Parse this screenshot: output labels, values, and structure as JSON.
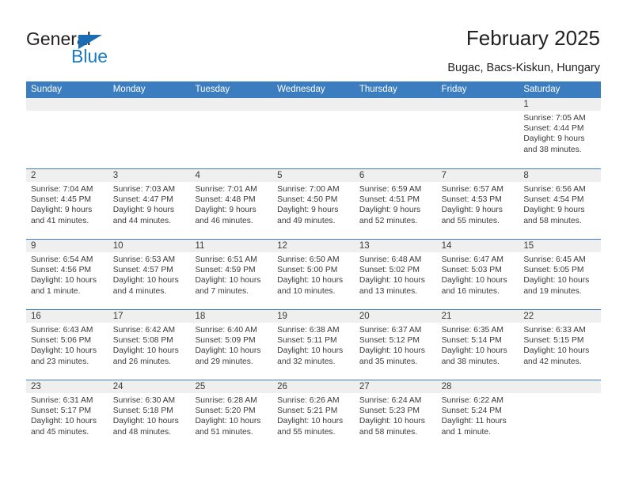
{
  "brand": {
    "word_general": "General",
    "word_blue": "Blue",
    "accent_color": "#3b7dbf",
    "logo_blue": "#1a7ac4"
  },
  "header": {
    "title": "February 2025",
    "subtitle": "Bugac, Bacs-Kiskun, Hungary"
  },
  "calendar": {
    "weekdays": [
      "Sunday",
      "Monday",
      "Tuesday",
      "Wednesday",
      "Thursday",
      "Friday",
      "Saturday"
    ],
    "weeks": [
      [
        {
          "day": "",
          "sunrise": "",
          "sunset": "",
          "daylight": "",
          "empty": true
        },
        {
          "day": "",
          "sunrise": "",
          "sunset": "",
          "daylight": "",
          "empty": true
        },
        {
          "day": "",
          "sunrise": "",
          "sunset": "",
          "daylight": "",
          "empty": true
        },
        {
          "day": "",
          "sunrise": "",
          "sunset": "",
          "daylight": "",
          "empty": true
        },
        {
          "day": "",
          "sunrise": "",
          "sunset": "",
          "daylight": "",
          "empty": true
        },
        {
          "day": "",
          "sunrise": "",
          "sunset": "",
          "daylight": "",
          "empty": true
        },
        {
          "day": "1",
          "sunrise": "Sunrise: 7:05 AM",
          "sunset": "Sunset: 4:44 PM",
          "daylight": "Daylight: 9 hours and 38 minutes.",
          "empty": false
        }
      ],
      [
        {
          "day": "2",
          "sunrise": "Sunrise: 7:04 AM",
          "sunset": "Sunset: 4:45 PM",
          "daylight": "Daylight: 9 hours and 41 minutes.",
          "empty": false
        },
        {
          "day": "3",
          "sunrise": "Sunrise: 7:03 AM",
          "sunset": "Sunset: 4:47 PM",
          "daylight": "Daylight: 9 hours and 44 minutes.",
          "empty": false
        },
        {
          "day": "4",
          "sunrise": "Sunrise: 7:01 AM",
          "sunset": "Sunset: 4:48 PM",
          "daylight": "Daylight: 9 hours and 46 minutes.",
          "empty": false
        },
        {
          "day": "5",
          "sunrise": "Sunrise: 7:00 AM",
          "sunset": "Sunset: 4:50 PM",
          "daylight": "Daylight: 9 hours and 49 minutes.",
          "empty": false
        },
        {
          "day": "6",
          "sunrise": "Sunrise: 6:59 AM",
          "sunset": "Sunset: 4:51 PM",
          "daylight": "Daylight: 9 hours and 52 minutes.",
          "empty": false
        },
        {
          "day": "7",
          "sunrise": "Sunrise: 6:57 AM",
          "sunset": "Sunset: 4:53 PM",
          "daylight": "Daylight: 9 hours and 55 minutes.",
          "empty": false
        },
        {
          "day": "8",
          "sunrise": "Sunrise: 6:56 AM",
          "sunset": "Sunset: 4:54 PM",
          "daylight": "Daylight: 9 hours and 58 minutes.",
          "empty": false
        }
      ],
      [
        {
          "day": "9",
          "sunrise": "Sunrise: 6:54 AM",
          "sunset": "Sunset: 4:56 PM",
          "daylight": "Daylight: 10 hours and 1 minute.",
          "empty": false
        },
        {
          "day": "10",
          "sunrise": "Sunrise: 6:53 AM",
          "sunset": "Sunset: 4:57 PM",
          "daylight": "Daylight: 10 hours and 4 minutes.",
          "empty": false
        },
        {
          "day": "11",
          "sunrise": "Sunrise: 6:51 AM",
          "sunset": "Sunset: 4:59 PM",
          "daylight": "Daylight: 10 hours and 7 minutes.",
          "empty": false
        },
        {
          "day": "12",
          "sunrise": "Sunrise: 6:50 AM",
          "sunset": "Sunset: 5:00 PM",
          "daylight": "Daylight: 10 hours and 10 minutes.",
          "empty": false
        },
        {
          "day": "13",
          "sunrise": "Sunrise: 6:48 AM",
          "sunset": "Sunset: 5:02 PM",
          "daylight": "Daylight: 10 hours and 13 minutes.",
          "empty": false
        },
        {
          "day": "14",
          "sunrise": "Sunrise: 6:47 AM",
          "sunset": "Sunset: 5:03 PM",
          "daylight": "Daylight: 10 hours and 16 minutes.",
          "empty": false
        },
        {
          "day": "15",
          "sunrise": "Sunrise: 6:45 AM",
          "sunset": "Sunset: 5:05 PM",
          "daylight": "Daylight: 10 hours and 19 minutes.",
          "empty": false
        }
      ],
      [
        {
          "day": "16",
          "sunrise": "Sunrise: 6:43 AM",
          "sunset": "Sunset: 5:06 PM",
          "daylight": "Daylight: 10 hours and 23 minutes.",
          "empty": false
        },
        {
          "day": "17",
          "sunrise": "Sunrise: 6:42 AM",
          "sunset": "Sunset: 5:08 PM",
          "daylight": "Daylight: 10 hours and 26 minutes.",
          "empty": false
        },
        {
          "day": "18",
          "sunrise": "Sunrise: 6:40 AM",
          "sunset": "Sunset: 5:09 PM",
          "daylight": "Daylight: 10 hours and 29 minutes.",
          "empty": false
        },
        {
          "day": "19",
          "sunrise": "Sunrise: 6:38 AM",
          "sunset": "Sunset: 5:11 PM",
          "daylight": "Daylight: 10 hours and 32 minutes.",
          "empty": false
        },
        {
          "day": "20",
          "sunrise": "Sunrise: 6:37 AM",
          "sunset": "Sunset: 5:12 PM",
          "daylight": "Daylight: 10 hours and 35 minutes.",
          "empty": false
        },
        {
          "day": "21",
          "sunrise": "Sunrise: 6:35 AM",
          "sunset": "Sunset: 5:14 PM",
          "daylight": "Daylight: 10 hours and 38 minutes.",
          "empty": false
        },
        {
          "day": "22",
          "sunrise": "Sunrise: 6:33 AM",
          "sunset": "Sunset: 5:15 PM",
          "daylight": "Daylight: 10 hours and 42 minutes.",
          "empty": false
        }
      ],
      [
        {
          "day": "23",
          "sunrise": "Sunrise: 6:31 AM",
          "sunset": "Sunset: 5:17 PM",
          "daylight": "Daylight: 10 hours and 45 minutes.",
          "empty": false
        },
        {
          "day": "24",
          "sunrise": "Sunrise: 6:30 AM",
          "sunset": "Sunset: 5:18 PM",
          "daylight": "Daylight: 10 hours and 48 minutes.",
          "empty": false
        },
        {
          "day": "25",
          "sunrise": "Sunrise: 6:28 AM",
          "sunset": "Sunset: 5:20 PM",
          "daylight": "Daylight: 10 hours and 51 minutes.",
          "empty": false
        },
        {
          "day": "26",
          "sunrise": "Sunrise: 6:26 AM",
          "sunset": "Sunset: 5:21 PM",
          "daylight": "Daylight: 10 hours and 55 minutes.",
          "empty": false
        },
        {
          "day": "27",
          "sunrise": "Sunrise: 6:24 AM",
          "sunset": "Sunset: 5:23 PM",
          "daylight": "Daylight: 10 hours and 58 minutes.",
          "empty": false
        },
        {
          "day": "28",
          "sunrise": "Sunrise: 6:22 AM",
          "sunset": "Sunset: 5:24 PM",
          "daylight": "Daylight: 11 hours and 1 minute.",
          "empty": false
        },
        {
          "day": "",
          "sunrise": "",
          "sunset": "",
          "daylight": "",
          "empty": true
        }
      ]
    ]
  }
}
